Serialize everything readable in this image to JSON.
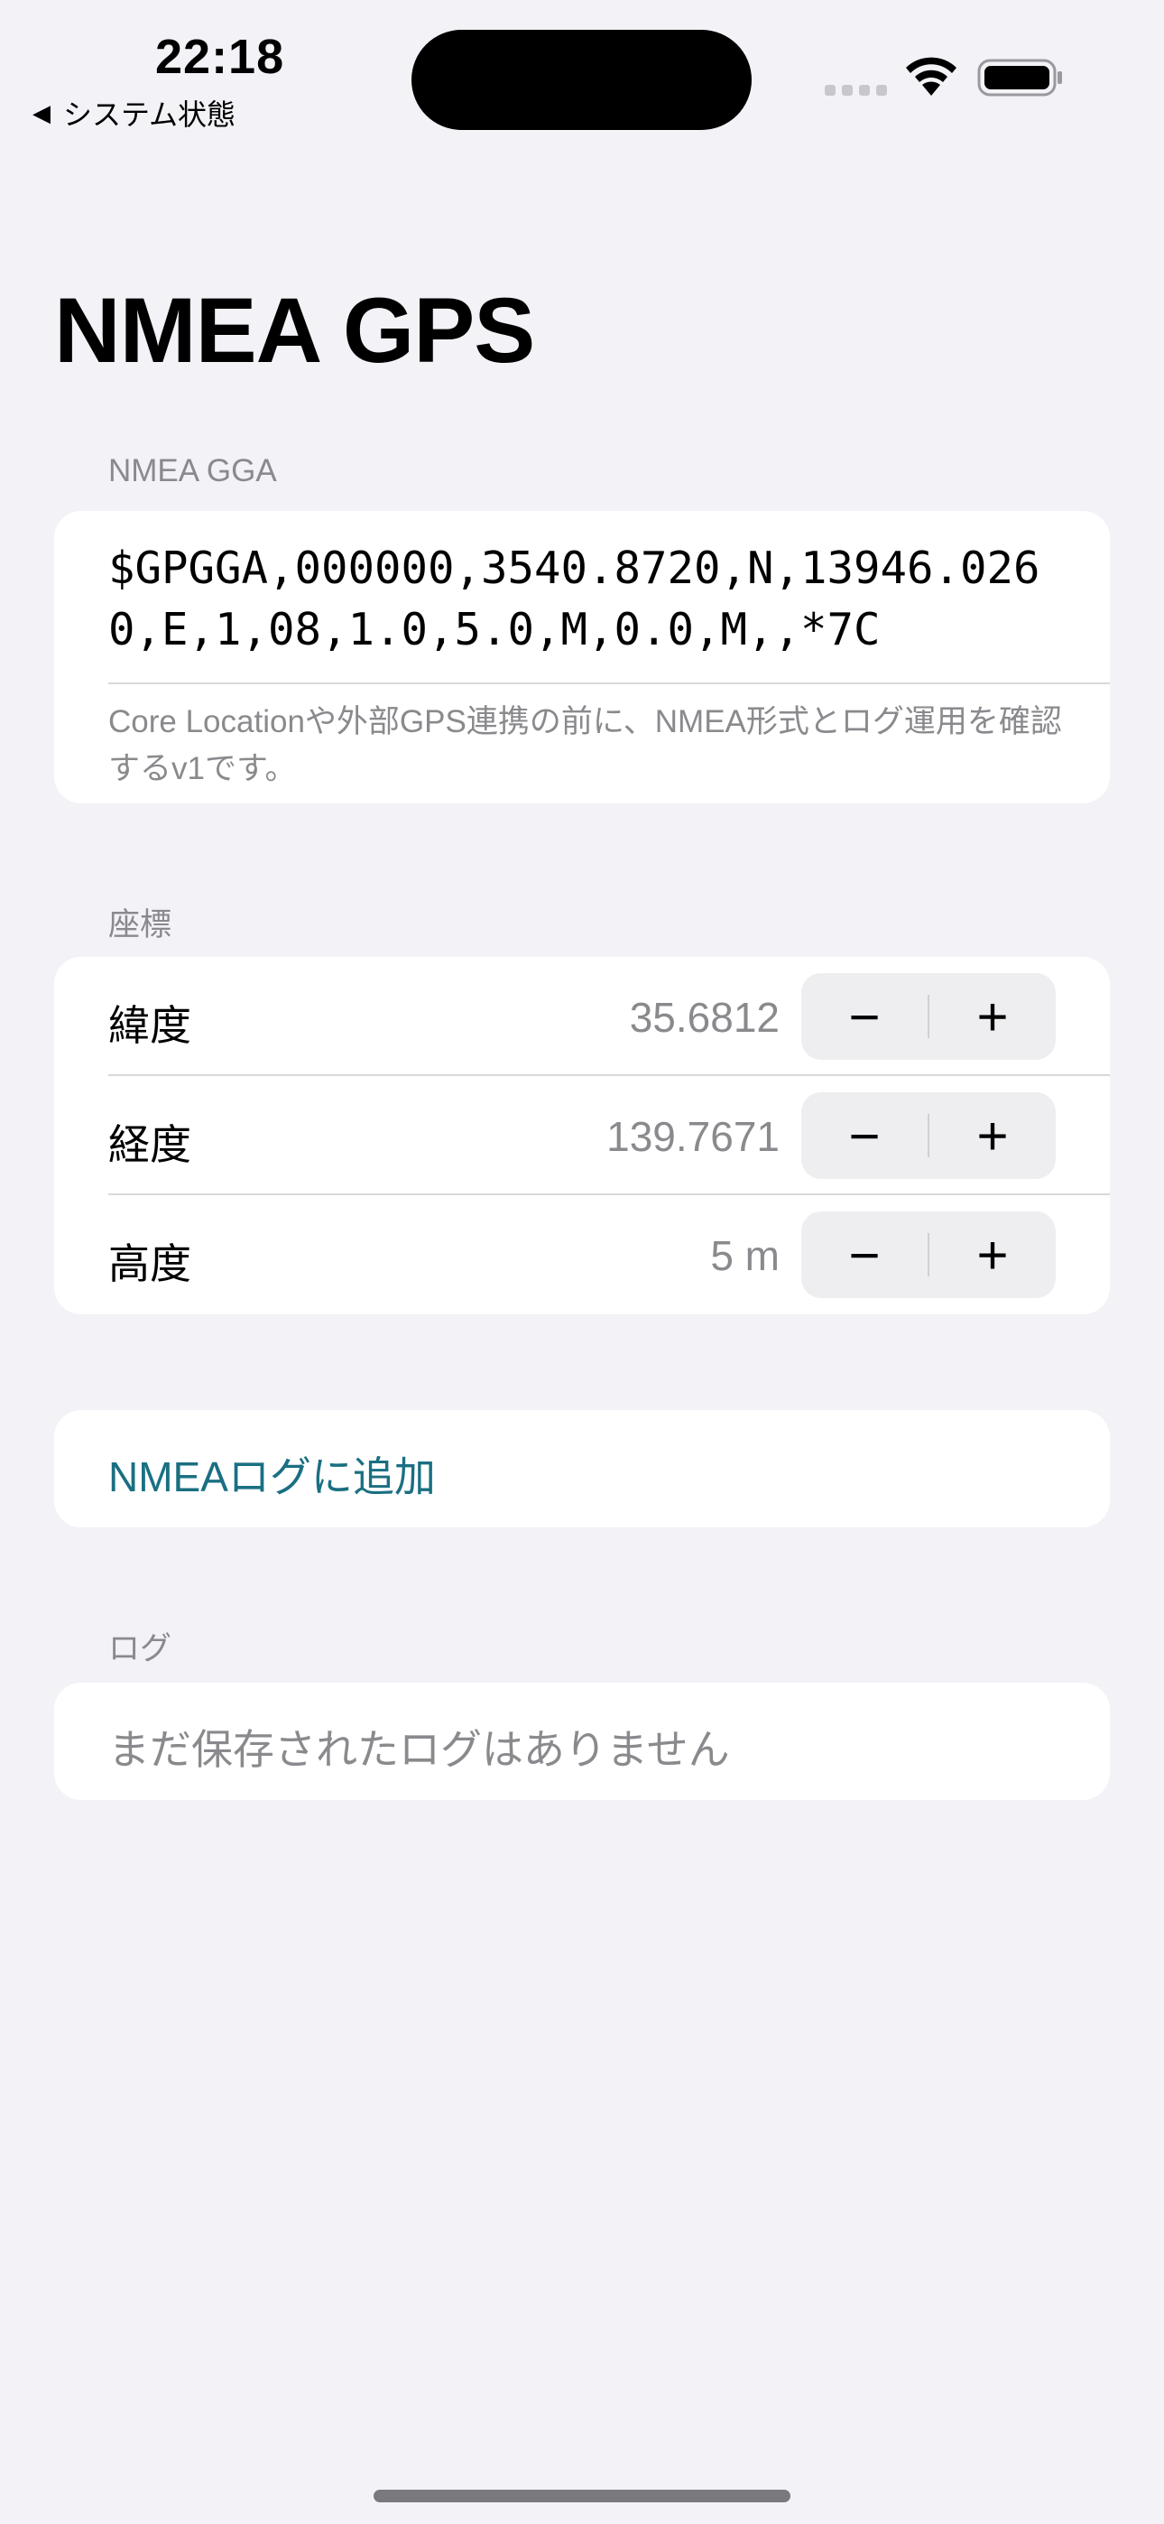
{
  "status_bar": {
    "time": "22:18",
    "back_label": "システム状態",
    "back_icon": "back-triangle-icon",
    "signal_icon": "cellular-signal-icon",
    "wifi_icon": "wifi-icon",
    "battery_icon": "battery-icon"
  },
  "page": {
    "title": "NMEA GPS"
  },
  "nmea_section": {
    "header": "NMEA GGA",
    "sentence": "$GPGGA,000000,3540.8720,N,13946.0260,E,1,08,1.0,5.0,M,0.0,M,,*7C",
    "footnote": "Core Locationや外部GPS連携の前に、NMEA形式とログ運用を確認するv1です。"
  },
  "coordinates_section": {
    "header": "座標",
    "rows": [
      {
        "label": "緯度",
        "value": "35.6812",
        "minus": "−",
        "plus": "+"
      },
      {
        "label": "経度",
        "value": "139.7671",
        "minus": "−",
        "plus": "+"
      },
      {
        "label": "高度",
        "value": "5 m",
        "minus": "−",
        "plus": "+"
      }
    ]
  },
  "actions": {
    "add_to_log": "NMEAログに追加"
  },
  "log_section": {
    "header": "ログ",
    "empty_text": "まだ保存されたログはありません"
  },
  "colors": {
    "background": "#f2f2f7",
    "card": "#ffffff",
    "accent_link": "#1a6f82",
    "secondary_text": "#8a8a8e"
  }
}
